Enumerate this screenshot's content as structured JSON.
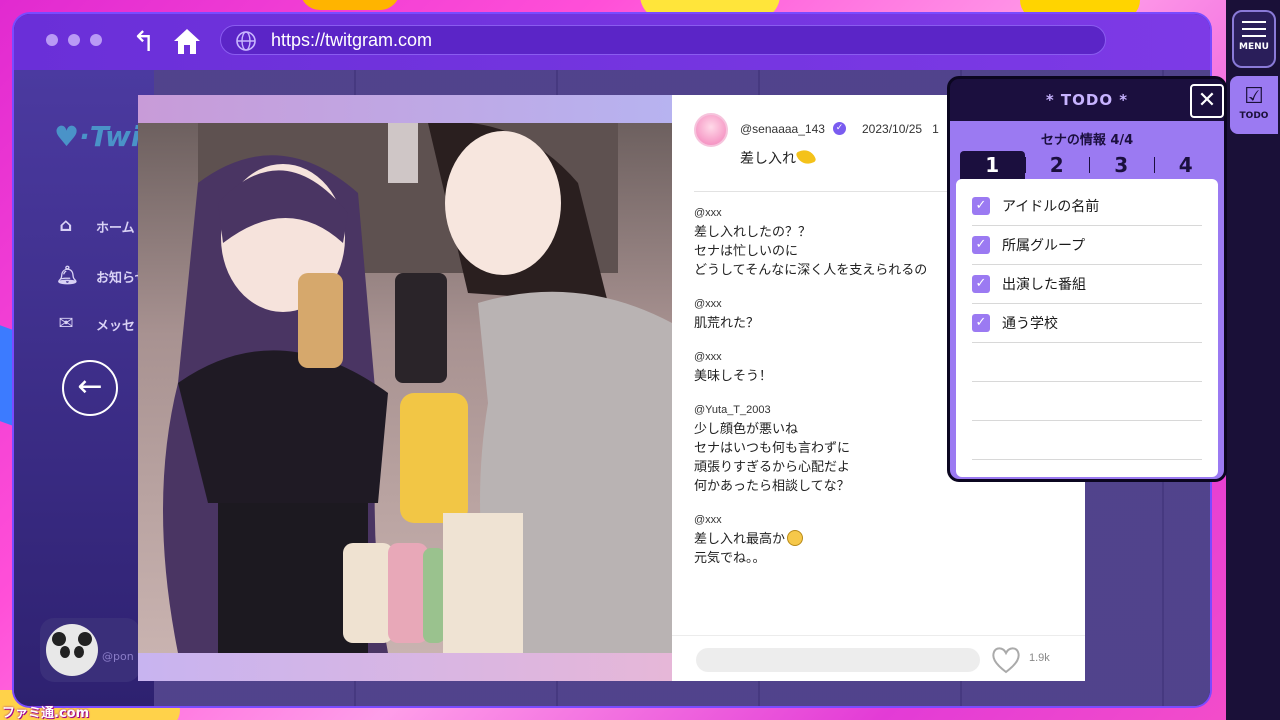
{
  "browser": {
    "url": "https://twitgram.com"
  },
  "site": {
    "logo": "Twit",
    "nav": [
      {
        "label": "ホーム",
        "icon": "home-icon"
      },
      {
        "label": "お知らせ",
        "icon": "bell-icon"
      },
      {
        "label": "メッセ",
        "icon": "mail-icon"
      }
    ],
    "user_handle": "@pon"
  },
  "post": {
    "handle": "@senaaaa_143",
    "date": "2023/10/25",
    "date_suffix": "1",
    "caption": "差し入れ",
    "comments": [
      {
        "user": "@xxx",
        "lines": [
          "差し入れしたの？？",
          "セナは忙しいのに",
          "どうしてそんなに深く人を支えられるの"
        ]
      },
      {
        "user": "@xxx",
        "lines": [
          "肌荒れた？"
        ]
      },
      {
        "user": "@xxx",
        "lines": [
          "美味しそう！"
        ]
      },
      {
        "user": "@Yuta_T_2003",
        "lines": [
          "少し顔色が悪いね",
          "セナはいつも何も言わずに",
          "頑張りすぎるから心配だよ",
          "何かあったら相談してな？"
        ]
      },
      {
        "user": "@xxx",
        "lines": [
          "差し入れ最高か",
          "元気でね。。"
        ]
      }
    ],
    "like_count": "1.9k"
  },
  "side_menu": {
    "menu_label": "MENU",
    "todo_label": "TODO"
  },
  "todo": {
    "title": "* TODO *",
    "subtitle": "セナの情報 4/4",
    "tabs": [
      "1",
      "2",
      "3",
      "4"
    ],
    "active_tab": 0,
    "items": [
      {
        "label": "アイドルの名前",
        "checked": true
      },
      {
        "label": "所属グループ",
        "checked": true
      },
      {
        "label": "出演した番組",
        "checked": true
      },
      {
        "label": "通う学校",
        "checked": true
      }
    ]
  },
  "watermark": "ファミ通.com",
  "colors": {
    "accent": "#9b7af2",
    "toolbar": "#6a2fd8",
    "panel_dark": "#1b0f3e"
  }
}
